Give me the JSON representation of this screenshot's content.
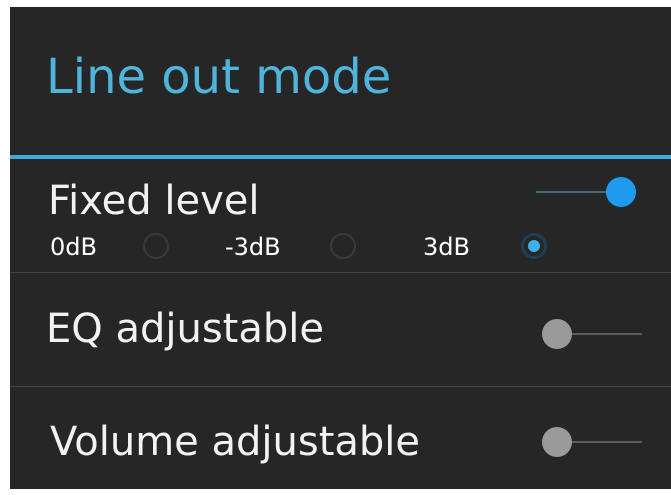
{
  "header": {
    "title": "Line out mode"
  },
  "fixed_level": {
    "label": "Fixed level",
    "toggle_on": true,
    "options": [
      {
        "label": "0dB",
        "selected": false
      },
      {
        "label": "-3dB",
        "selected": false
      },
      {
        "label": "3dB",
        "selected": true
      }
    ]
  },
  "eq_adjustable": {
    "label": "EQ adjustable",
    "toggle_on": false
  },
  "volume_adjustable": {
    "label": "Volume adjustable",
    "toggle_on": false
  },
  "colors": {
    "accent": "#3ea9d9",
    "title": "#4fb4dc",
    "toggle_on": "#1e9bef",
    "toggle_off": "#9a9a9a",
    "background": "#262626"
  }
}
